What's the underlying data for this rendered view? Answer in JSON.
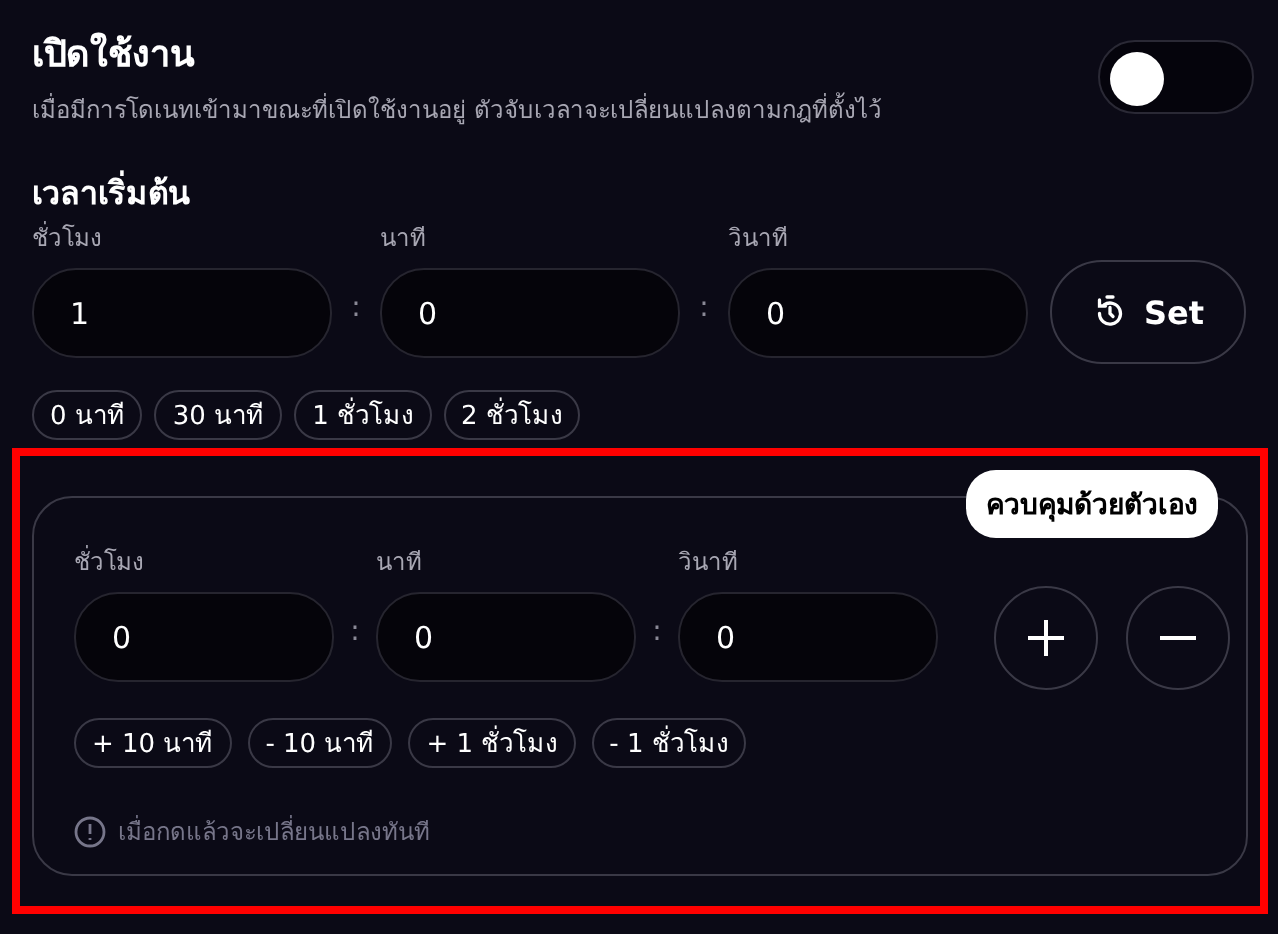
{
  "toggle_section": {
    "title": "เปิดใช้งาน",
    "description": "เมื่อมีการโดเนทเข้ามาขณะที่เปิดใช้งานอยู่ ตัวจับเวลาจะเปลี่ยนแปลงตามกฎที่ตั้งไว้",
    "enabled": false
  },
  "start_time": {
    "title": "เวลาเริ่มต้น",
    "fields": [
      {
        "label": "ชั่วโมง",
        "value": "1"
      },
      {
        "separator": ":",
        "label": "นาที",
        "value": "0"
      },
      {
        "separator": ":",
        "label": "วินาที",
        "value": "0"
      }
    ],
    "set_button": "Set",
    "presets": [
      "0 นาที",
      "30 นาที",
      "1 ชั่วโมง",
      "2 ชั่วโมง"
    ]
  },
  "manual_control": {
    "badge": "ควบคุมด้วยตัวเอง",
    "fields": [
      {
        "label": "ชั่วโมง",
        "value": "0"
      },
      {
        "separator": ":",
        "label": "นาที",
        "value": "0"
      },
      {
        "separator": ":",
        "label": "วินาที",
        "value": "0"
      }
    ],
    "adjust_chips": [
      "+ 10 นาที",
      "- 10 นาที",
      "+ 1 ชั่วโมง",
      "- 1 ชั่วโมง"
    ],
    "note": "เมื่อกดแล้วจะเปลี่ยนแปลงทันที"
  }
}
